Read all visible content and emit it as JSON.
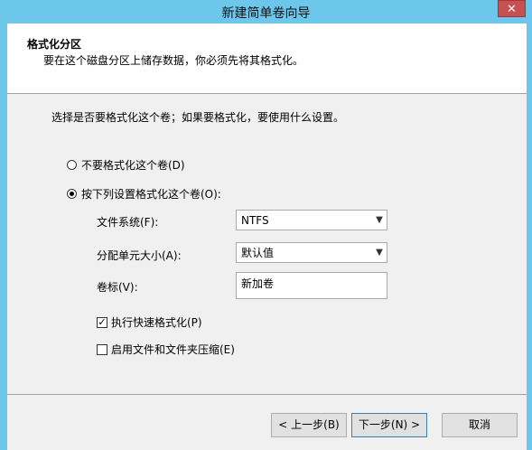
{
  "window": {
    "title": "新建简单卷向导",
    "close_label": "✕"
  },
  "header": {
    "title": "格式化分区",
    "subtitle": "要在这个磁盘分区上储存数据，你必须先将其格式化。"
  },
  "body": {
    "prompt": "选择是否要格式化这个卷；如果要格式化，要使用什么设置。",
    "options": {
      "no_format": {
        "label": "不要格式化这个卷(D)",
        "checked": false
      },
      "format": {
        "label": "按下列设置格式化这个卷(O):",
        "checked": true
      }
    },
    "file_system": {
      "label": "文件系统(F):",
      "value": "NTFS"
    },
    "allocation_unit": {
      "label": "分配单元大小(A):",
      "value": "默认值"
    },
    "volume_label": {
      "label": "卷标(V):",
      "value": "新加卷"
    },
    "quick_format": {
      "label": "执行快速格式化(P)",
      "checked": true
    },
    "compression": {
      "label": "启用文件和文件夹压缩(E)",
      "checked": false
    }
  },
  "buttons": {
    "back": "< 上一步(B)",
    "next": "下一步(N) >",
    "cancel": "取消"
  },
  "icons": {
    "dropdown": "chevron-down-icon",
    "check": "checkmark-icon"
  }
}
